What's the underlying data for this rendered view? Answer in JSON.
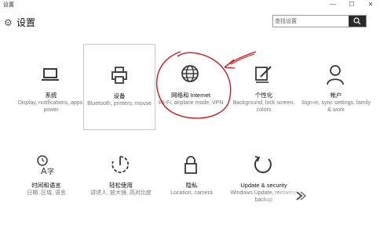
{
  "window": {
    "title": "设置"
  },
  "header": {
    "title": "设置"
  },
  "search": {
    "placeholder": "查找设置"
  },
  "tiles": [
    {
      "name": "系统",
      "desc": "Display, notifications, apps, power",
      "icon": "laptop-icon"
    },
    {
      "name": "设备",
      "desc": "Bluetooth, printers, mouse",
      "icon": "printer-icon"
    },
    {
      "name": "网络和 Internet",
      "desc": "Wi-Fi, airplane mode, VPN",
      "icon": "globe-icon"
    },
    {
      "name": "个性化",
      "desc": "Background, lock screen, colors",
      "icon": "paint-icon"
    },
    {
      "name": "帐户",
      "desc": "Sign-in, sync settings, family & work",
      "icon": "person-icon"
    },
    {
      "name": "时间和语言",
      "desc": "日期, 区域, 语言",
      "icon": "time-language-icon"
    },
    {
      "name": "轻松使用",
      "desc": "讲述人, 放大镜, 高对比度",
      "icon": "ease-of-access-icon"
    },
    {
      "name": "隐私",
      "desc": "Location, camera",
      "icon": "lock-icon"
    },
    {
      "name": "Update & security",
      "desc": "Windows Update, recovery, backup",
      "icon": "refresh-icon"
    }
  ],
  "colors": {
    "icon": "#3a3a3a",
    "annotation": "#d01818",
    "search_button": "#2a2a2a"
  }
}
